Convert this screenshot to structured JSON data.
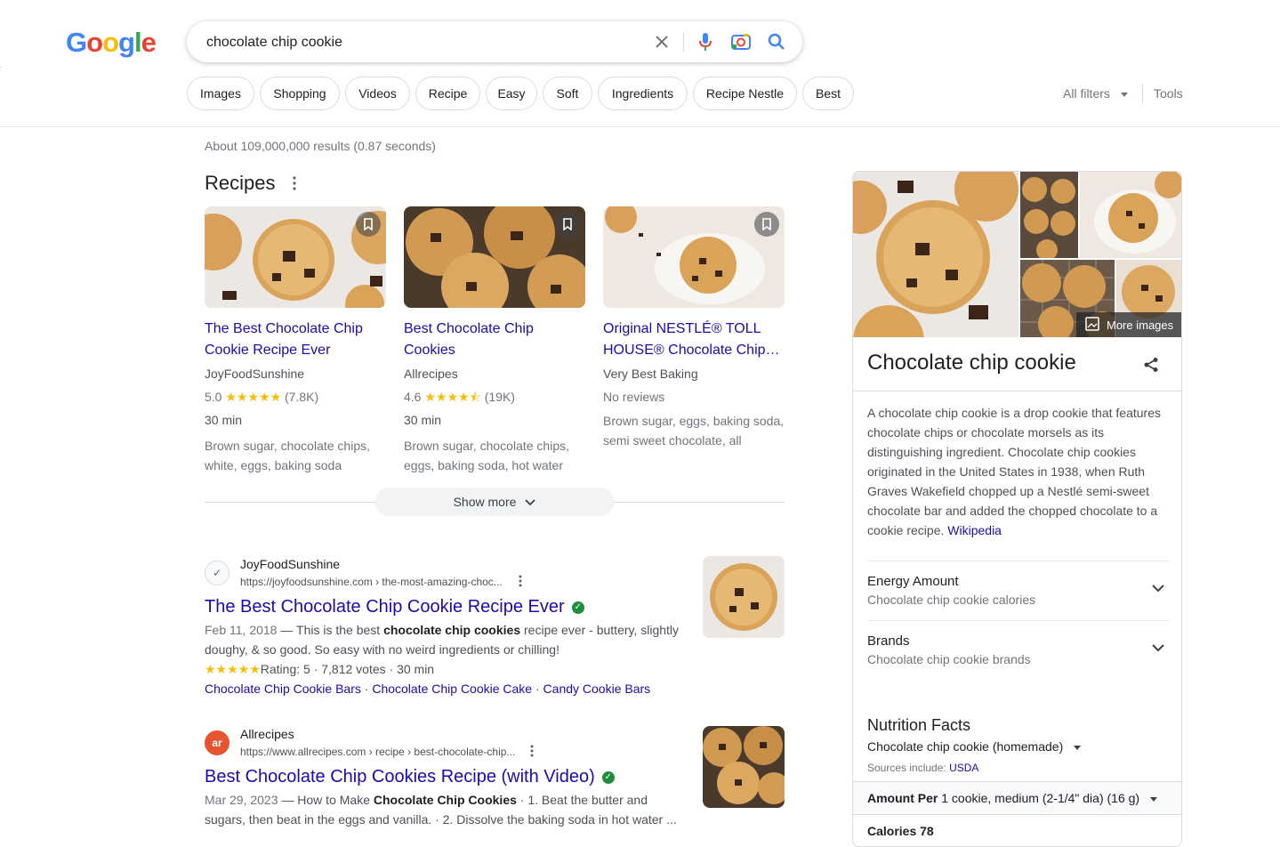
{
  "header": {
    "logo_letters": [
      "G",
      "o",
      "o",
      "g",
      "l",
      "e"
    ],
    "search_query": "chocolate chip cookie",
    "chips": [
      "Images",
      "Shopping",
      "Videos",
      "Recipe",
      "Easy",
      "Soft",
      "Ingredients",
      "Recipe Nestle",
      "Best"
    ],
    "all_filters_label": "All filters",
    "tools_label": "Tools"
  },
  "result_stats": "About 109,000,000 results (0.87 seconds)",
  "recipes": {
    "title": "Recipes",
    "cards": [
      {
        "title": "The Best Chocolate Chip Cookie Recipe Ever",
        "source": "JoyFoodSunshine",
        "rating": "5.0",
        "stars": "★★★★★",
        "votes": "(7.8K)",
        "time": "30 min",
        "ingredients": "Brown sugar, chocolate chips, white, eggs, baking soda"
      },
      {
        "title": "Best Chocolate Chip Cookies",
        "source": "Allrecipes",
        "rating": "4.6",
        "stars": "★★★★⯪",
        "votes": "(19K)",
        "time": "30 min",
        "ingredients": "Brown sugar, chocolate chips, eggs, baking soda, hot water"
      },
      {
        "title": "Original NESTLÉ® TOLL HOUSE® Chocolate Chip…",
        "source": "Very Best Baking",
        "no_reviews": "No reviews",
        "ingredients": "Brown sugar, eggs, baking soda, semi sweet chocolate, all"
      }
    ],
    "show_more_label": "Show more"
  },
  "results": [
    {
      "site_name": "JoyFoodSunshine",
      "favicon_text": "✓",
      "url": "https://joyfoodsunshine.com › the-most-amazing-choc...",
      "title": "The Best Chocolate Chip Cookie Recipe Ever",
      "date": "Feb 11, 2018",
      "snippet_pre": " — This is the best ",
      "snippet_bold": "chocolate chip cookies",
      "snippet_post": " recipe ever - buttery, slightly doughy, & so good. So easy with no weird ingredients or chilling!",
      "rating_stars": "★★★★★",
      "rating_text": "Rating: 5 · 7,812 votes · 30 min",
      "sublinks": [
        "Chocolate Chip Cookie Bars",
        "Chocolate Chip Cookie Cake",
        "Candy Cookie Bars"
      ]
    },
    {
      "site_name": "Allrecipes",
      "favicon_text": "ar",
      "url": "https://www.allrecipes.com › recipe › best-chocolate-chip...",
      "title": "Best Chocolate Chip Cookies Recipe (with Video)",
      "date": "Mar 29, 2023",
      "snippet_pre": " — How to Make ",
      "snippet_bold": "Chocolate Chip Cookies",
      "snippet_post": " · 1. Beat the butter and sugars, then beat in the eggs and vanilla. · 2. Dissolve the baking soda in hot water ..."
    }
  ],
  "knowledge_panel": {
    "more_images_label": "More images",
    "title": "Chocolate chip cookie",
    "description": "A chocolate chip cookie is a drop cookie that features chocolate chips or chocolate morsels as its distinguishing ingredient. Chocolate chip cookies originated in the United States in 1938, when Ruth Graves Wakefield chopped up a Nestlé semi-sweet chocolate bar and added the chopped chocolate to a cookie recipe.",
    "description_link": "Wikipedia",
    "rows": [
      {
        "label": "Energy Amount",
        "sub": "Chocolate chip cookie calories"
      },
      {
        "label": "Brands",
        "sub": "Chocolate chip cookie brands"
      }
    ],
    "nutrition": {
      "title": "Nutrition Facts",
      "subtitle": "Chocolate chip cookie (homemade)",
      "sources_prefix": "Sources include: ",
      "sources_link": "USDA",
      "amount_label": "Amount Per",
      "amount_value": "1 cookie, medium (2-1/4\" dia) (16 g)",
      "calories": "Calories 78"
    }
  },
  "colors": {
    "link": "#1a0dab",
    "google_blue": "#4285f4",
    "google_red": "#ea4335",
    "google_yellow": "#fbbc05",
    "google_green": "#34a853",
    "star": "#fbbc04",
    "verified": "#1e8e3e"
  }
}
